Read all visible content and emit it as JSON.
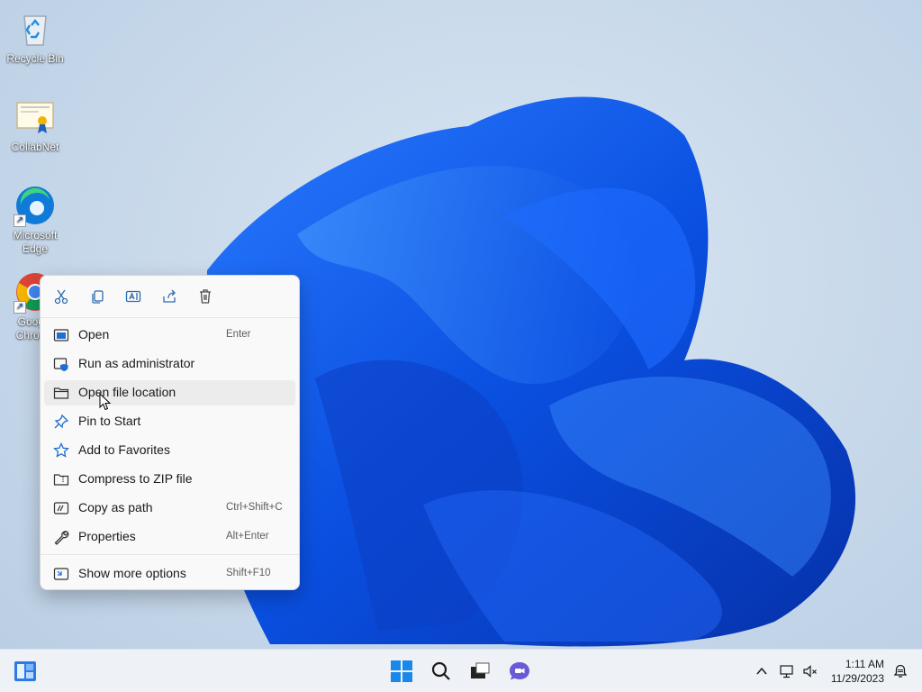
{
  "desktop": {
    "icons": [
      {
        "label": "Recycle Bin"
      },
      {
        "label": "CollabNet"
      },
      {
        "label": "Microsoft Edge"
      },
      {
        "label": "Google Chrome"
      }
    ]
  },
  "context_menu": {
    "toolbar": [
      {
        "icon": "cut-icon"
      },
      {
        "icon": "copy-icon"
      },
      {
        "icon": "rename-icon"
      },
      {
        "icon": "share-icon"
      },
      {
        "icon": "delete-icon"
      }
    ],
    "items": [
      {
        "label": "Open",
        "shortcut": "Enter",
        "icon": "app-window-icon"
      },
      {
        "label": "Run as administrator",
        "shortcut": "",
        "icon": "shield-window-icon"
      },
      {
        "label": "Open file location",
        "shortcut": "",
        "icon": "folder-icon"
      },
      {
        "label": "Pin to Start",
        "shortcut": "",
        "icon": "pin-icon"
      },
      {
        "label": "Add to Favorites",
        "shortcut": "",
        "icon": "star-icon"
      },
      {
        "label": "Compress to ZIP file",
        "shortcut": "",
        "icon": "zip-folder-icon"
      },
      {
        "label": "Copy as path",
        "shortcut": "Ctrl+Shift+C",
        "icon": "copy-path-icon"
      },
      {
        "label": "Properties",
        "shortcut": "Alt+Enter",
        "icon": "wrench-icon"
      },
      {
        "label": "Show more options",
        "shortcut": "Shift+F10",
        "icon": "more-options-icon"
      }
    ]
  },
  "taskbar": {
    "time": "1:11 AM",
    "date": "11/29/2023"
  },
  "colors": {
    "accent": "#0067c0",
    "menu_bg": "#f9f9f9",
    "taskbar_bg": "#eef1f5"
  }
}
